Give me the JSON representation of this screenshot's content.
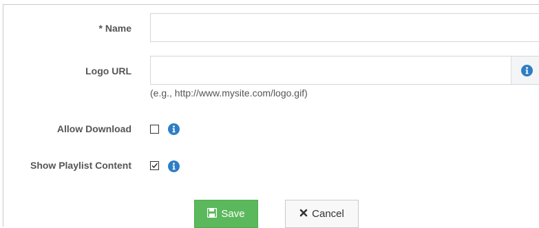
{
  "form": {
    "name": {
      "label": "* Name",
      "value": ""
    },
    "logo_url": {
      "label": "Logo URL",
      "value": "",
      "help": "(e.g., http://www.mysite.com/logo.gif)",
      "addon_icon": "info-icon"
    },
    "allow_download": {
      "label": "Allow Download",
      "checked": false,
      "icon": "info-icon"
    },
    "show_playlist_content": {
      "label": "Show Playlist Content",
      "checked": true,
      "icon": "info-icon"
    }
  },
  "actions": {
    "save_label": "Save",
    "save_icon": "floppy-disk-icon",
    "cancel_label": "Cancel",
    "cancel_icon": "close-icon"
  },
  "colors": {
    "info_blue": "#2d7ec4",
    "save_green": "#5cb85c"
  }
}
